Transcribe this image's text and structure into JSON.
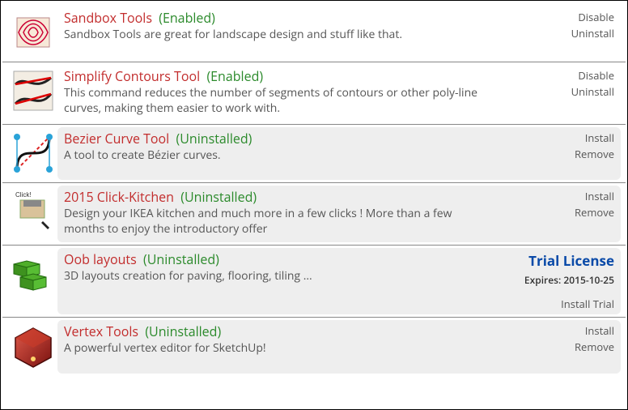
{
  "extensions": [
    {
      "name": "Sandbox Tools",
      "status": "(Enabled)",
      "description": "Sandbox Tools are great for landscape design and stuff like that.",
      "actions": [
        "Disable",
        "Uninstall"
      ],
      "shaded": false,
      "icon": "sandbox"
    },
    {
      "name": "Simplify Contours Tool",
      "status": "(Enabled)",
      "description": "This command reduces the number of segments of contours or other poly-line curves, making them easier to work with.",
      "actions": [
        "Disable",
        "Uninstall"
      ],
      "shaded": false,
      "icon": "simplify"
    },
    {
      "name": "Bezier Curve Tool",
      "status": "(Uninstalled)",
      "description": "A tool to create Bézier curves.",
      "actions": [
        "Install",
        "Remove"
      ],
      "shaded": true,
      "icon": "bezier"
    },
    {
      "name": "2015 Click-Kitchen",
      "status": "(Uninstalled)",
      "description": "Design your IKEA kitchen and much more in a few clicks ! More than a few months to enjoy the introductory offer",
      "actions": [
        "Install",
        "Remove"
      ],
      "shaded": true,
      "icon": "kitchen"
    },
    {
      "name": "Oob layouts",
      "status": "(Uninstalled)",
      "description": "3D layouts creation for paving, flooring, tiling ...",
      "trial": {
        "title": "Trial License",
        "expires": "Expires: 2015-10-25"
      },
      "actions": [
        "Install Trial"
      ],
      "shaded": true,
      "icon": "oob"
    },
    {
      "name": "Vertex Tools",
      "status": "(Uninstalled)",
      "description": "A powerful vertex editor for SketchUp!",
      "actions": [
        "Install",
        "Remove"
      ],
      "shaded": true,
      "icon": "vertex"
    }
  ]
}
